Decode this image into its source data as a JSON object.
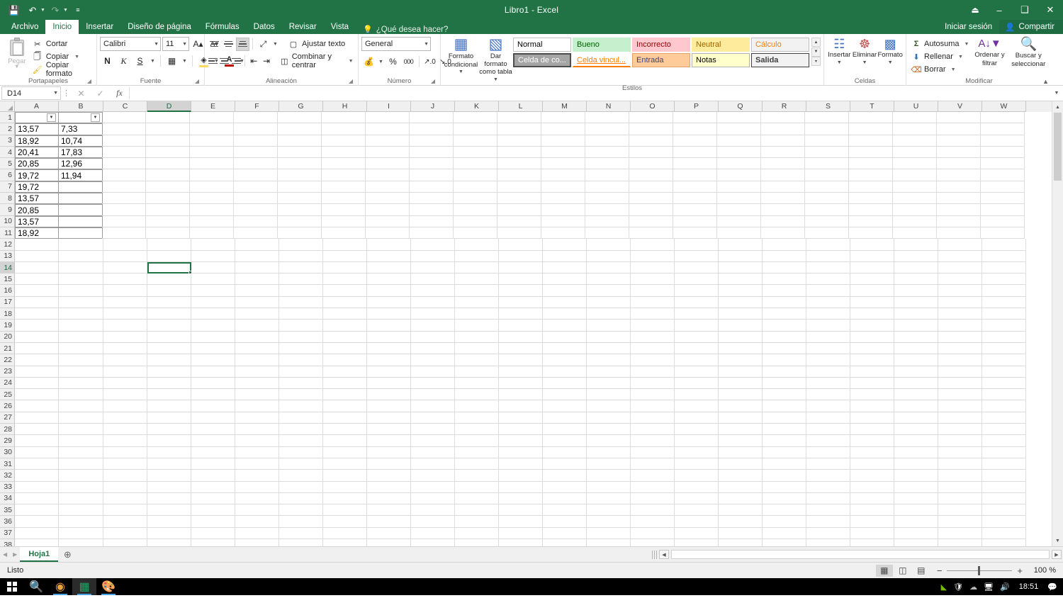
{
  "window": {
    "title": "Libro1 - Excel",
    "quick_access": [
      "save-icon",
      "undo-icon",
      "redo-icon",
      "customize-qat-icon"
    ],
    "ribbon_display_options": "ribbon-display-icon",
    "minimize": "minimize-icon",
    "restore": "restore-icon",
    "close": "close-icon"
  },
  "tabs": [
    {
      "label": "Archivo",
      "active": false
    },
    {
      "label": "Inicio",
      "active": true
    },
    {
      "label": "Insertar",
      "active": false
    },
    {
      "label": "Diseño de página",
      "active": false
    },
    {
      "label": "Fórmulas",
      "active": false
    },
    {
      "label": "Datos",
      "active": false
    },
    {
      "label": "Revisar",
      "active": false
    },
    {
      "label": "Vista",
      "active": false
    }
  ],
  "tell_me": "¿Qué desea hacer?",
  "account": {
    "sign_in": "Iniciar sesión",
    "share": "Compartir"
  },
  "ribbon": {
    "clipboard": {
      "label": "Portapapeles",
      "paste": "Pegar",
      "cut": "Cortar",
      "copy": "Copiar",
      "format_painter": "Copiar formato"
    },
    "font": {
      "label": "Fuente",
      "font_name": "Calibri",
      "font_size": "11",
      "bold": "N",
      "italic": "K",
      "underline": "S"
    },
    "alignment": {
      "label": "Alineación",
      "wrap_text": "Ajustar texto",
      "merge_center": "Combinar y centrar"
    },
    "number": {
      "label": "Número",
      "format": "General",
      "percent": "%",
      "thousands": "000"
    },
    "styles": {
      "label": "Estilos",
      "conditional_formatting": "Formato\ncondicional",
      "conditional_formatting_l1": "Formato",
      "conditional_formatting_l2": "condicional",
      "format_as_table_l1": "Dar formato",
      "format_as_table_l2": "como tabla",
      "gallery": [
        {
          "name": "Normal",
          "bg": "#ffffff",
          "fg": "#000000",
          "border": "#bfbfbf"
        },
        {
          "name": "Bueno",
          "bg": "#c6efce",
          "fg": "#006100",
          "border": "#c6efce"
        },
        {
          "name": "Incorrecto",
          "bg": "#ffc7ce",
          "fg": "#9c0006",
          "border": "#ffc7ce"
        },
        {
          "name": "Neutral",
          "bg": "#ffeb9c",
          "fg": "#9c6500",
          "border": "#ffeb9c"
        },
        {
          "name": "Cálculo",
          "bg": "#f2f2f2",
          "fg": "#fa7d00",
          "border": "#bfbfbf"
        },
        {
          "name": "Celda de co...",
          "bg": "#a5a5a5",
          "fg": "#ffffff",
          "border": "#4d4d4d"
        },
        {
          "name": "Celda vincul...",
          "bg": "#ffffff",
          "fg": "#fa7d00",
          "border": "#ffffff"
        },
        {
          "name": "Entrada",
          "bg": "#ffcc99",
          "fg": "#3f3f76",
          "border": "#dfa26b"
        },
        {
          "name": "Notas",
          "bg": "#ffffcc",
          "fg": "#000000",
          "border": "#b2b2b2"
        },
        {
          "name": "Salida",
          "bg": "#f2f2f2",
          "fg": "#3f3f3f",
          "border": "#3f3f3f"
        }
      ]
    },
    "cells": {
      "label": "Celdas",
      "insert": "Insertar",
      "delete": "Eliminar",
      "format": "Formato"
    },
    "editing": {
      "label": "Modificar",
      "autosum": "Autosuma",
      "fill": "Rellenar",
      "clear": "Borrar",
      "sort_filter_l1": "Ordenar y",
      "sort_filter_l2": "filtrar",
      "find_select_l1": "Buscar y",
      "find_select_l2": "seleccionar"
    }
  },
  "formula_bar": {
    "name_box": "D14",
    "formula": "",
    "cancel_icon": "cancel-icon",
    "enter_icon": "confirm-icon",
    "function_icon": "insert-function-icon"
  },
  "grid": {
    "columns": [
      "A",
      "B",
      "C",
      "D",
      "E",
      "F",
      "G",
      "H",
      "I",
      "J",
      "K",
      "L",
      "M",
      "N",
      "O",
      "P",
      "Q",
      "R",
      "S",
      "T",
      "U",
      "V",
      "W"
    ],
    "selected_column": "D",
    "selected_row": 14,
    "selected_cell": "D14",
    "rows": [
      1,
      2,
      3,
      4,
      5,
      6,
      7,
      8,
      9,
      10,
      11,
      12,
      13,
      14,
      15,
      16,
      17,
      18,
      19,
      20,
      21,
      22,
      23,
      24,
      25,
      26,
      27,
      28,
      29,
      30,
      31,
      32,
      33,
      34,
      35,
      36,
      37,
      38
    ],
    "table": {
      "header_row": 1,
      "header_filters": [
        "filter-dropdown-icon",
        "filter-dropdown-icon"
      ],
      "column_a": [
        "13,57",
        "18,92",
        "20,41",
        "20,85",
        "19,72",
        "19,72",
        "13,57",
        "20,85",
        "13,57",
        "18,92"
      ],
      "column_b": [
        "7,33",
        "10,74",
        "17,83",
        "12,96",
        "11,94",
        "",
        "",
        "",
        "",
        ""
      ],
      "first_data_row": 2,
      "last_data_row": 11
    }
  },
  "sheet_tabs": {
    "sheets": [
      "Hoja1"
    ],
    "active": "Hoja1",
    "add_sheet": "add-sheet-icon",
    "prev": "prev-sheet-icon",
    "next": "next-sheet-icon"
  },
  "status_bar": {
    "status": "Listo",
    "views": [
      "normal-view-icon",
      "page-layout-icon",
      "page-break-preview-icon"
    ],
    "active_view": "normal-view-icon",
    "zoom_out": "−",
    "zoom_in": "+",
    "zoom": "100 %"
  },
  "taskbar": {
    "start": "windows-start-icon",
    "search": "search-icon",
    "apps": [
      "chrome-icon",
      "excel-icon",
      "paint-icon"
    ],
    "active_app": "excel-icon",
    "tray": [
      "nvidia-icon",
      "security-warning-icon",
      "onedrive-icon",
      "network-icon",
      "volume-icon"
    ],
    "clock": "18:51",
    "notifications": "notifications-icon"
  }
}
